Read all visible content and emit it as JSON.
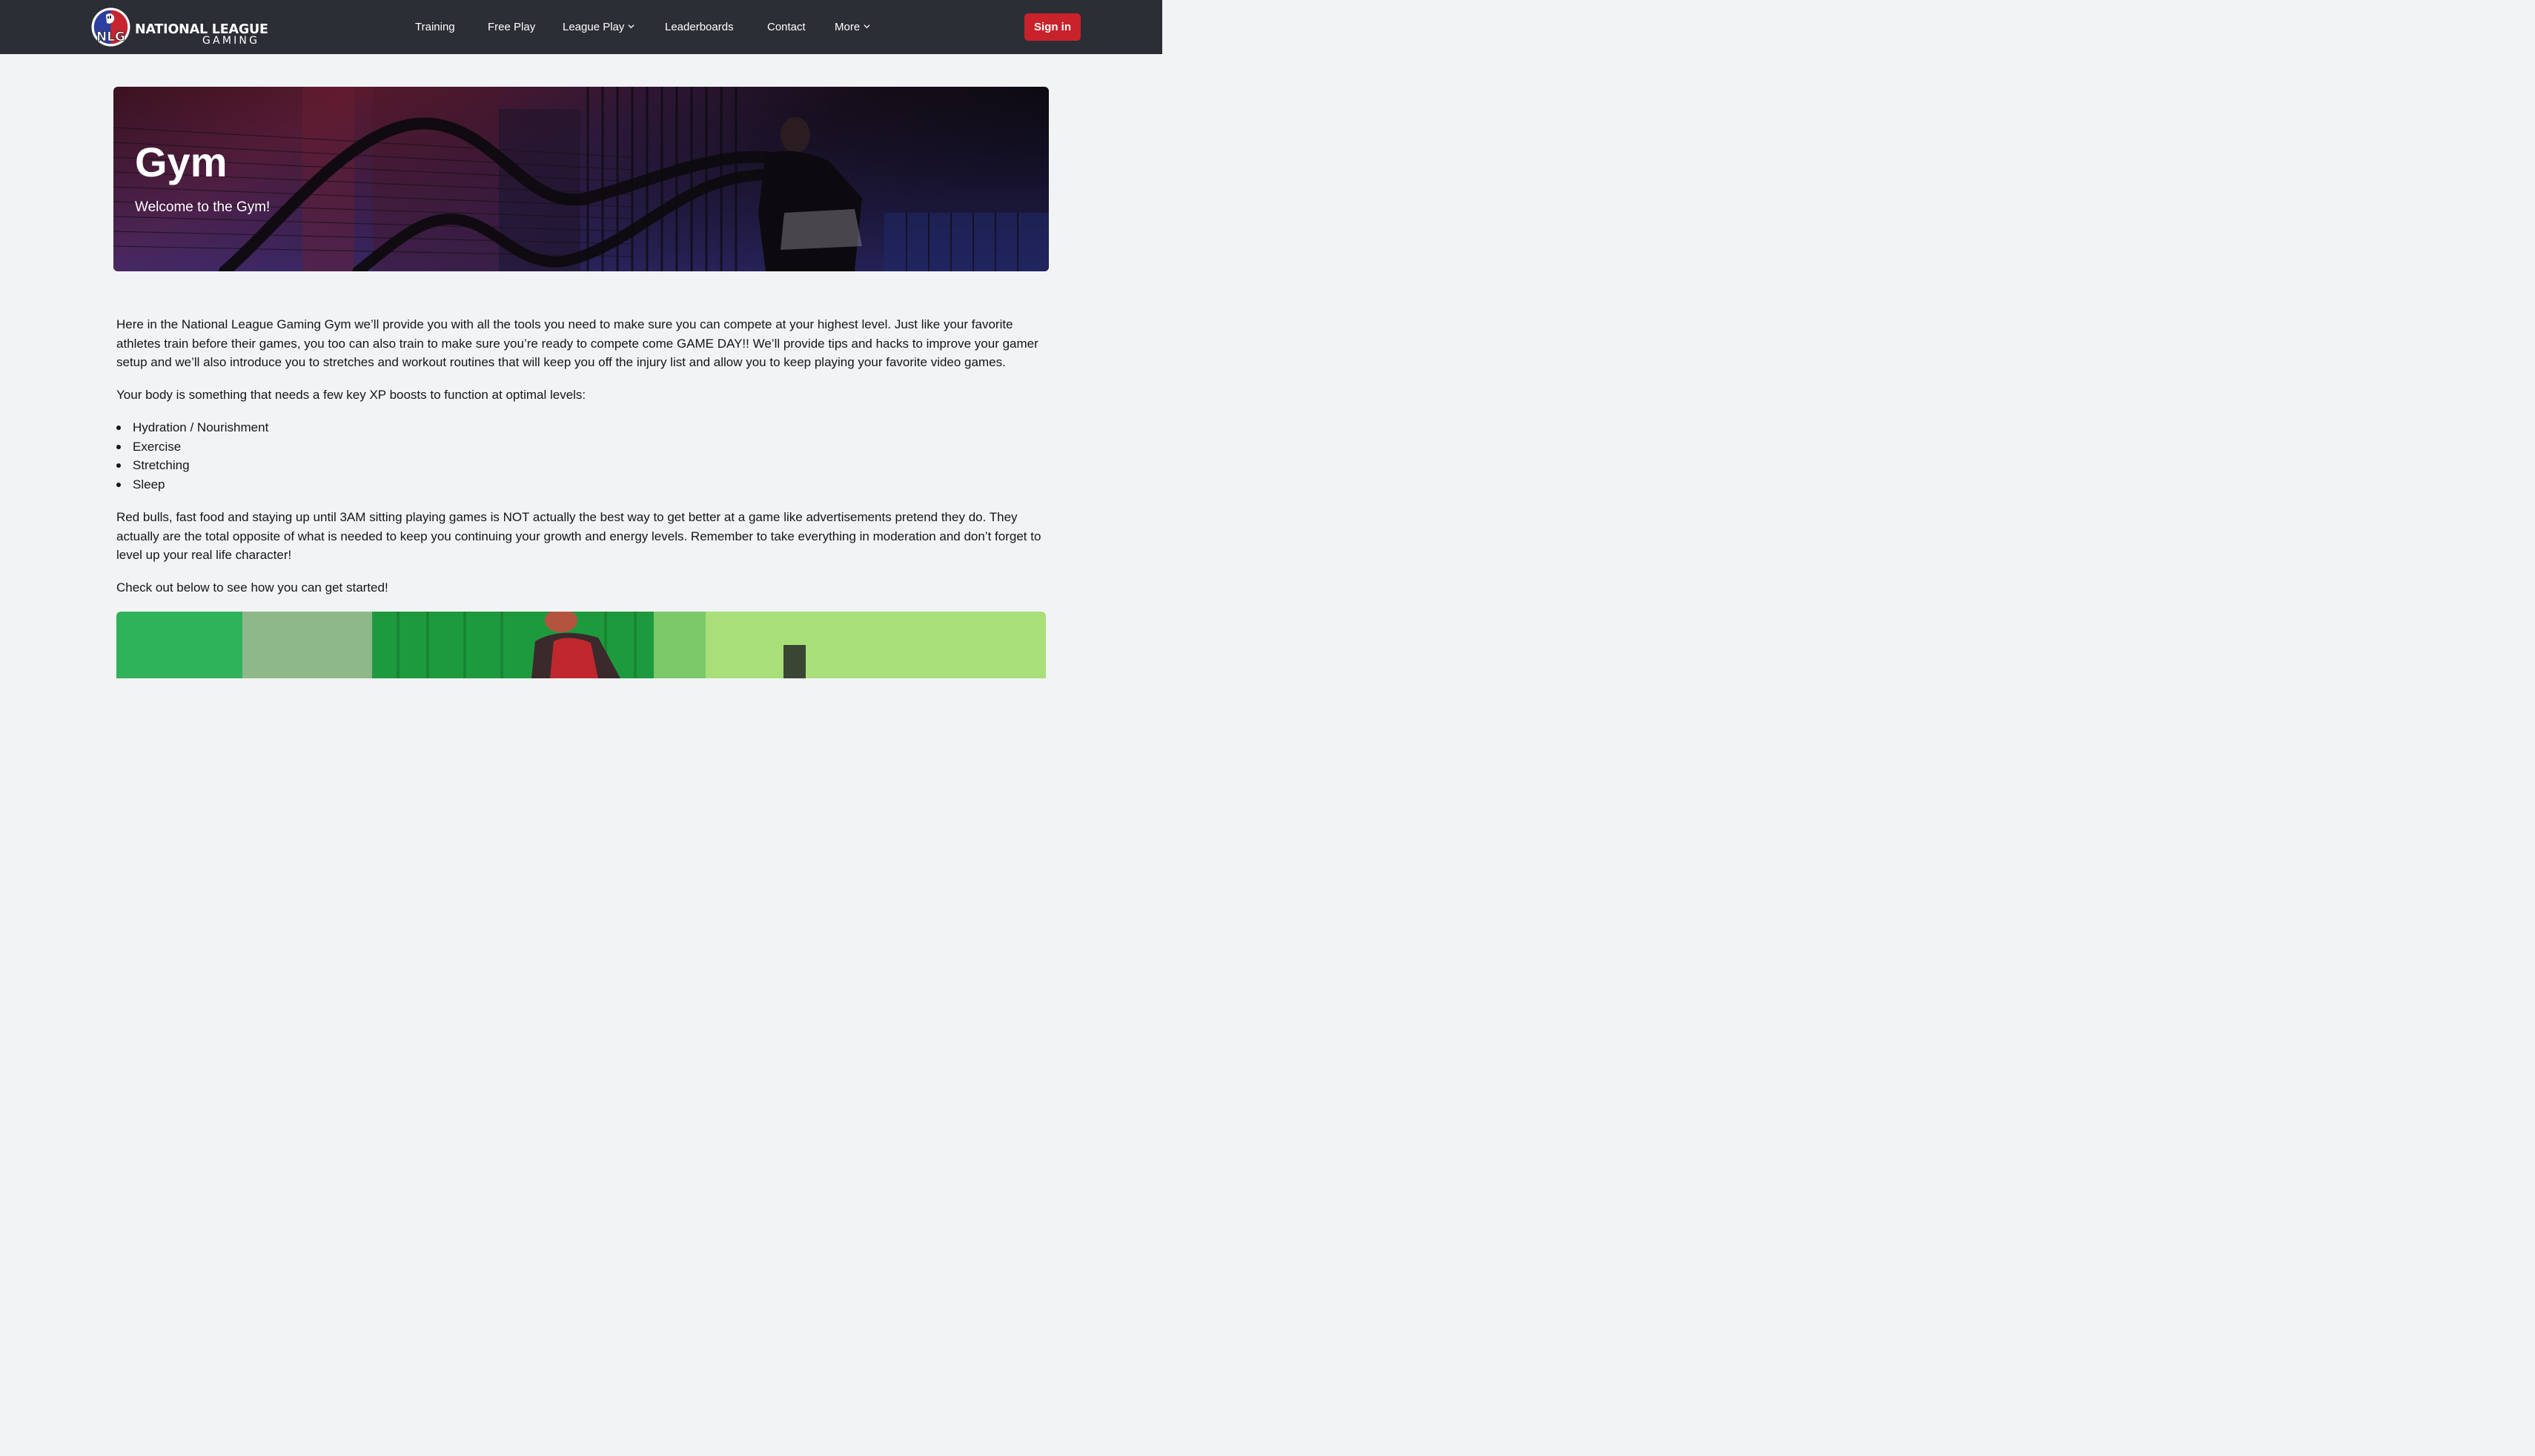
{
  "header": {
    "logo_title": "NATIONAL LEAGUE",
    "logo_subtitle": "GAMING",
    "logo_badge_text": "NLG",
    "nav": {
      "training": "Training",
      "free_play": "Free Play",
      "league_play": "League Play",
      "leaderboards": "Leaderboards",
      "contact": "Contact",
      "more": "More"
    },
    "sign_in": "Sign in"
  },
  "hero": {
    "title": "Gym",
    "subtitle": "Welcome to the Gym!"
  },
  "content": {
    "intro": "Here in the National League Gaming Gym we’ll provide you with all the tools you need to make sure you can compete at your highest level. Just like your favorite athletes train before their games, you too can also train to make sure you’re ready to compete come GAME DAY!! We’ll provide tips and hacks to improve your gamer setup and we’ll also introduce you to stretches and workout routines that will keep you off the injury list and allow you to keep playing your favorite video games.",
    "lead": "Your body is something that needs a few key XP boosts to function at optimal levels:",
    "boosts": [
      "Hydration / Nourishment",
      "Exercise",
      "Stretching",
      "Sleep"
    ],
    "warning": "Red bulls, fast food and staying up until 3AM sitting playing games is NOT actually the best way to get better at a game like advertisements pretend they do. They actually are the total opposite of what is needed to keep you continuing your growth and energy levels. Remember to take everything in moderation and don’t forget to level up your real life character!",
    "cta": "Check out below to see how you can get started!"
  },
  "colors": {
    "header_bg": "#2b2e34",
    "page_bg": "#f2f3f5",
    "accent_red": "#c8222a",
    "text": "#14161a"
  },
  "icons": {
    "dropdown": "chevron-down-icon",
    "logo": "nlg-badge-icon"
  }
}
